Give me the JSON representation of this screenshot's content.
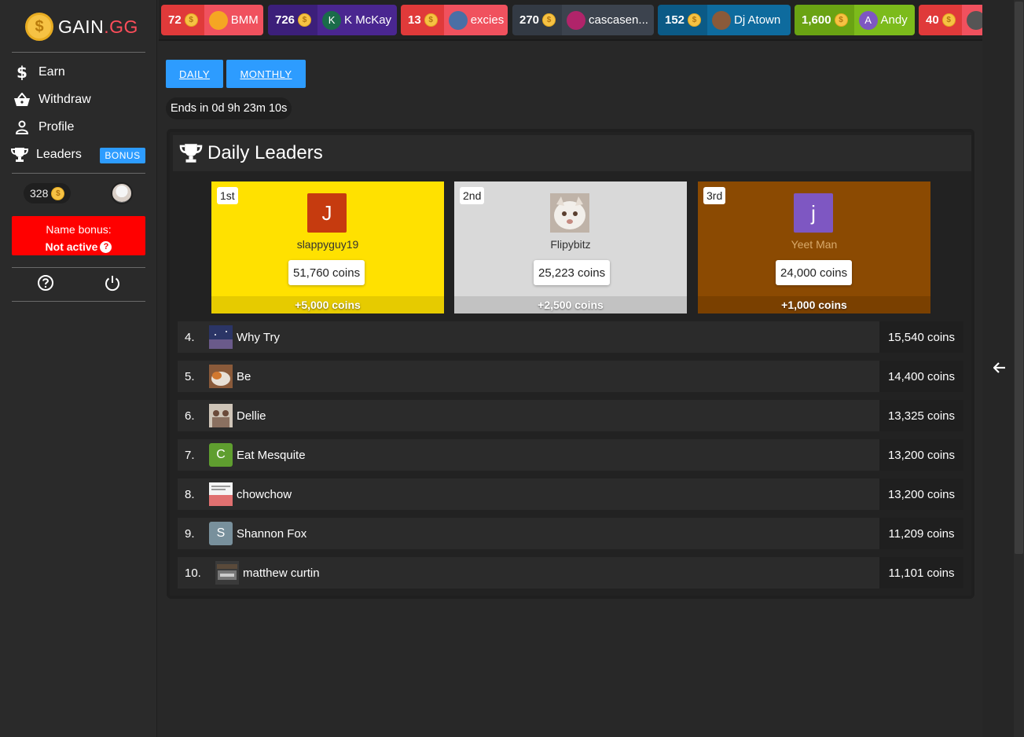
{
  "logo": {
    "coin_symbol": "$",
    "text_main": "GAIN",
    "text_accent": ".GG"
  },
  "nav": [
    {
      "label": "Earn",
      "icon": "dollar-icon"
    },
    {
      "label": "Withdraw",
      "icon": "basket-icon"
    },
    {
      "label": "Profile",
      "icon": "user-icon"
    },
    {
      "label": "Leaders",
      "icon": "trophy-icon",
      "badge": "BONUS"
    }
  ],
  "balance": {
    "amount": "328",
    "coin_symbol": "$"
  },
  "name_bonus": {
    "title": "Name bonus:",
    "status": "Not active",
    "help": "?"
  },
  "ticker": [
    {
      "amount": "72",
      "user": "BMM",
      "amt_color": "#e03a3a",
      "user_color": "#f0515e",
      "avatar_color": "#f5a623",
      "avatar_text": ""
    },
    {
      "amount": "726",
      "user": "K McKay",
      "amt_color": "#3c1f7a",
      "user_color": "#4a2690",
      "avatar_color": "#1a6b4a",
      "avatar_text": "K"
    },
    {
      "amount": "13",
      "user": "excies",
      "amt_color": "#e03a3a",
      "user_color": "#f0515e",
      "avatar_color": "#4a6fa5",
      "avatar_text": ""
    },
    {
      "amount": "270",
      "user": "cascasen...",
      "amt_color": "#333a44",
      "user_color": "#3c434e",
      "avatar_color": "#b0246a",
      "avatar_text": ""
    },
    {
      "amount": "152",
      "user": "Dj Atown",
      "amt_color": "#0b5a86",
      "user_color": "#0e6b9e",
      "avatar_color": "#8a5a3a",
      "avatar_text": ""
    },
    {
      "amount": "1,600",
      "user": "Andy",
      "amt_color": "#6aa313",
      "user_color": "#7cbb1b",
      "avatar_color": "#7e57c2",
      "avatar_text": "A"
    },
    {
      "amount": "40",
      "user": "",
      "amt_color": "#e03a3a",
      "user_color": "#f0515e",
      "avatar_color": "#555",
      "avatar_text": ""
    }
  ],
  "period": {
    "daily": "DAILY",
    "monthly": "MONTHLY"
  },
  "countdown": "Ends in 0d 9h 23m 10s",
  "panel_title": "Daily Leaders",
  "podium": [
    {
      "rank": "1st",
      "name": "slappyguy19",
      "coins": "51,760 coins",
      "bonus": "+5,000 coins",
      "initial": "J",
      "bg": "#ffe100",
      "bonus_bg": "#e6cb00",
      "avatar_bg": "#c63b0f",
      "name_color": "#333"
    },
    {
      "rank": "2nd",
      "name": "Flipybitz",
      "coins": "25,223 coins",
      "bonus": "+2,500 coins",
      "initial": "",
      "bg": "#d9d9d9",
      "bonus_bg": "#c2c2c2",
      "avatar_bg": "#cfc3b9",
      "name_color": "#333"
    },
    {
      "rank": "3rd",
      "name": "Yeet Man",
      "coins": "24,000 coins",
      "bonus": "+1,000 coins",
      "initial": "j",
      "bg": "#8b4a02",
      "bonus_bg": "#7a4000",
      "avatar_bg": "#7e57c2",
      "name_color": "#d8a96a"
    }
  ],
  "leaders": [
    {
      "num": "4.",
      "name": "Why Try",
      "coins": "15,540 coins",
      "initial": "",
      "avatar_bg": "#3a3f6a"
    },
    {
      "num": "5.",
      "name": "Be",
      "coins": "14,400 coins",
      "initial": "",
      "avatar_bg": "#c9692c"
    },
    {
      "num": "6.",
      "name": "Dellie",
      "coins": "13,325 coins",
      "initial": "",
      "avatar_bg": "#8d7a6a"
    },
    {
      "num": "7.",
      "name": "Eat Mesquite",
      "coins": "13,200 coins",
      "initial": "C",
      "avatar_bg": "#5f9e2f"
    },
    {
      "num": "8.",
      "name": "chowchow",
      "coins": "13,200 coins",
      "initial": "",
      "avatar_bg": "#e07070"
    },
    {
      "num": "9.",
      "name": "Shannon Fox",
      "coins": "11,209 coins",
      "initial": "S",
      "avatar_bg": "#78909c"
    },
    {
      "num": "10.",
      "name": "matthew curtin",
      "coins": "11,101 coins",
      "initial": "",
      "avatar_bg": "#4a4a4a"
    }
  ]
}
